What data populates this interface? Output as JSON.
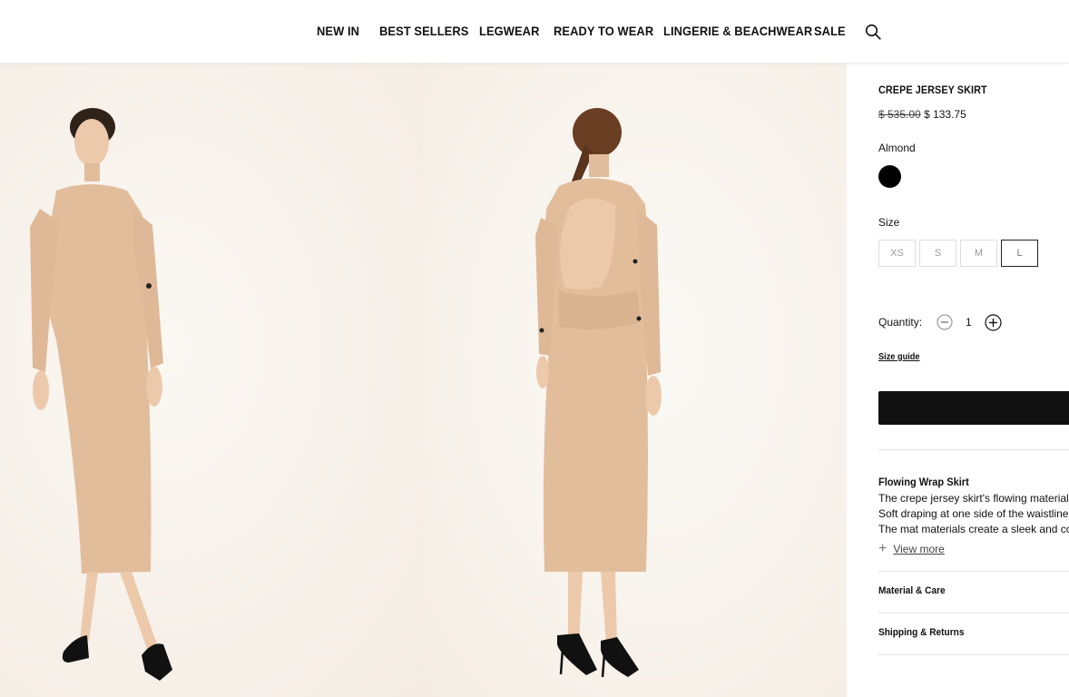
{
  "nav": {
    "items": [
      "NEW IN",
      "BEST SELLERS",
      "LEGWEAR",
      "READY TO WEAR",
      "LINGERIE & BEACHWEAR",
      "SALE"
    ],
    "search_icon": "search-icon"
  },
  "gallery": {
    "skin_color": "#e6c3a2",
    "dress_color": "#e2bd9c",
    "shoe_color": "#111111"
  },
  "product": {
    "title": "CREPE JERSEY SKIRT",
    "price_old": "$ 535.00",
    "price_new": "$ 133.75",
    "color_name": "Almond",
    "swatch_color": "#000000",
    "size_label": "Size",
    "sizes": [
      "XS",
      "S",
      "M",
      "L"
    ],
    "selected_size": "L",
    "quantity_label": "Quantity:",
    "quantity": "1",
    "size_guide": "Size guide",
    "description_title": "Flowing Wrap Skirt",
    "description_lines": [
      "The crepe jersey skirt's flowing material",
      "Soft draping at one side of the waistline",
      "The mat materials create a sleek and co"
    ],
    "view_more": "View more",
    "accordions": [
      "Material & Care",
      "Shipping & Returns"
    ]
  }
}
